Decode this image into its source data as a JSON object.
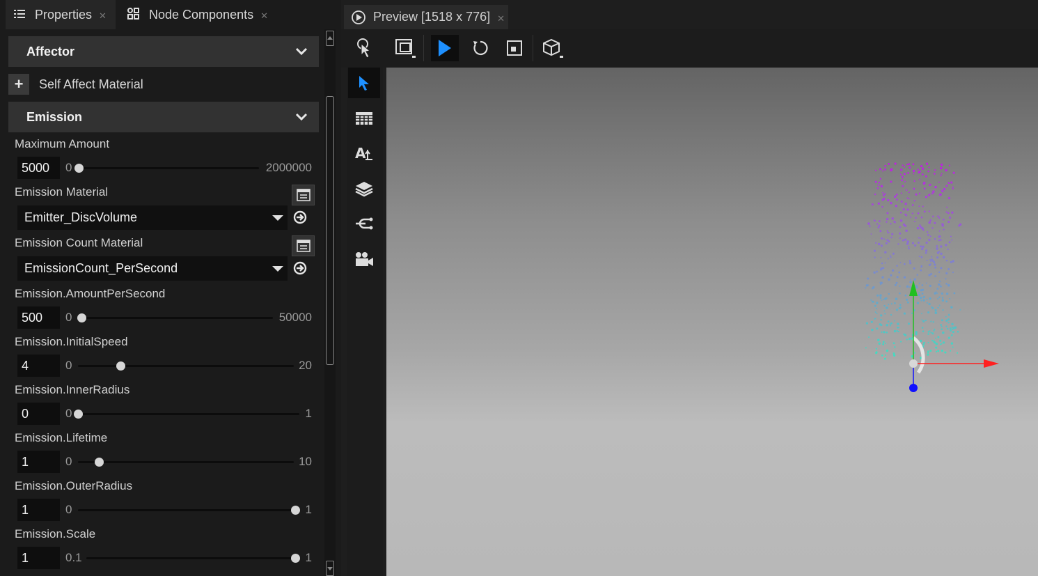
{
  "tabs": {
    "properties": "Properties",
    "node_components": "Node Components"
  },
  "sections": {
    "affector": "Affector",
    "self_affect": "Self Affect Material",
    "emission": "Emission"
  },
  "properties": {
    "maximum_amount": {
      "label": "Maximum Amount",
      "value": "5000",
      "min": "0",
      "max": "2000000",
      "fraction": 0.0025
    },
    "emission_material": {
      "label": "Emission Material",
      "value": "Emitter_DiscVolume"
    },
    "emission_count_material": {
      "label": "Emission Count Material",
      "value": "EmissionCount_PerSecond"
    },
    "amount_per_second": {
      "label": "Emission.AmountPerSecond",
      "value": "500",
      "min": "0",
      "max": "50000",
      "fraction": 0.01
    },
    "initial_speed": {
      "label": "Emission.InitialSpeed",
      "value": "4",
      "min": "0",
      "max": "20",
      "fraction": 0.2
    },
    "inner_radius": {
      "label": "Emission.InnerRadius",
      "value": "0",
      "min": "0",
      "max": "1",
      "fraction": 0
    },
    "lifetime": {
      "label": "Emission.Lifetime",
      "value": "1",
      "min": "0",
      "max": "10",
      "fraction": 0.1
    },
    "outer_radius": {
      "label": "Emission.OuterRadius",
      "value": "1",
      "min": "0",
      "max": "1",
      "fraction": 1
    },
    "scale": {
      "label": "Emission.Scale",
      "value": "1",
      "min": "0.1",
      "max": "1",
      "fraction": 1
    }
  },
  "preview": {
    "tab_title": "Preview [1518 x 776]"
  },
  "colors": {
    "accent": "#1e90ff",
    "particle_top": "#c020e0",
    "particle_bottom": "#40e0c0",
    "axis_x": "#ff2020",
    "axis_y": "#20c020",
    "axis_z": "#1010ff"
  },
  "icons": {
    "properties_tab": "list-icon",
    "node_components_tab": "components-icon",
    "preview_tab": "play-circle-icon"
  }
}
